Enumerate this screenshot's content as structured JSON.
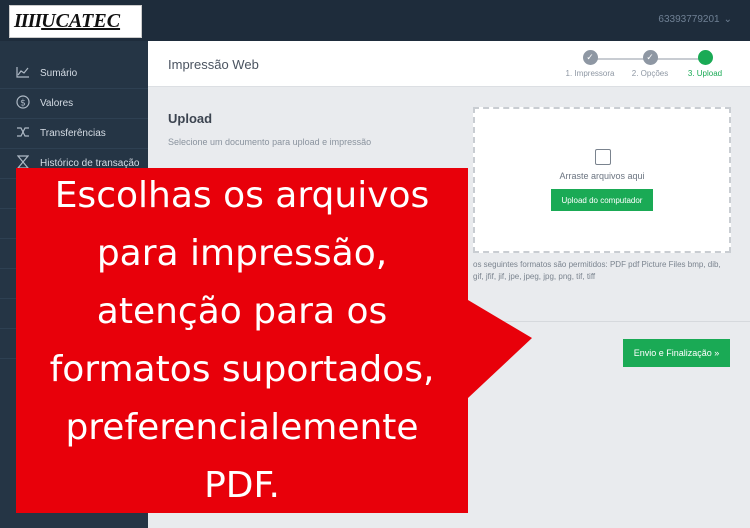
{
  "topbar": {
    "logo_bars": "IIII",
    "logo_text": "UCATEC",
    "account_label": "63393779201",
    "account_chevron": "chevron-down-icon"
  },
  "sidebar": {
    "items": [
      {
        "label": "Sumário",
        "icon": "chart-line-icon"
      },
      {
        "label": "Valores",
        "icon": "dollar-circle-icon"
      },
      {
        "label": "Transferências",
        "icon": "shuffle-icon"
      },
      {
        "label": "Histórico de transação",
        "icon": "hourglass-icon"
      }
    ]
  },
  "main": {
    "title": "Impressão Web",
    "steps": [
      {
        "label": "1. Impressora",
        "state": "done"
      },
      {
        "label": "2. Opções",
        "state": "done"
      },
      {
        "label": "3. Upload",
        "state": "active"
      }
    ],
    "upload": {
      "title": "Upload",
      "description": "Selecione um documento para upload e impressão",
      "drop_text": "Arraste arquivos aqui",
      "upload_button": "Upload do computador",
      "formats_text": "os seguintes formatos são permitidos: PDF pdf Picture Files bmp, dib, gif, jfif, jif, jpe, jpeg, jpg, png, tif, tiff"
    },
    "submit_button": "Envio e Finalização »"
  },
  "callout": {
    "lines": [
      "Escolhas os arquivos",
      "para impressão,",
      "atenção para os",
      "formatos suportados,",
      "preferencialemente",
      "PDF."
    ],
    "color": "#e8000a"
  },
  "colors": {
    "accent_green": "#1aaa55",
    "sidebar": "#253545",
    "topbar": "#1e2c3b"
  }
}
